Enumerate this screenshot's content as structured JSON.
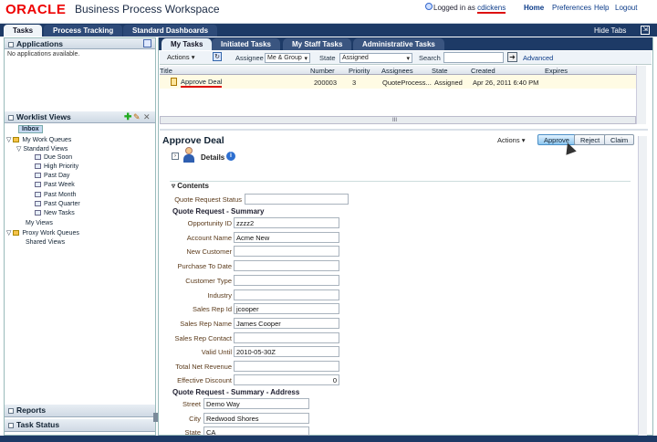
{
  "header": {
    "brand": "ORACLE",
    "app_title": "Business Process Workspace",
    "logged_in_prefix": "Logged in as",
    "user": "cdickens",
    "links": [
      "Home",
      "Preferences",
      "Help",
      "Logout"
    ]
  },
  "main_tabs": [
    "Tasks",
    "Process Tracking",
    "Standard Dashboards"
  ],
  "hide_tabs": "Hide Tabs",
  "left": {
    "applications_title": "Applications",
    "no_apps": "No applications available.",
    "worklist_title": "Worklist Views",
    "tree": [
      "Inbox",
      "My Work Queues",
      "Standard Views",
      "Due Soon",
      "High Priority",
      "Past Day",
      "Past Week",
      "Past Month",
      "Past Quarter",
      "New Tasks",
      "My Views",
      "Proxy Work Queues",
      "Shared Views"
    ],
    "reports_title": "Reports",
    "taskstatus_title": "Task Status"
  },
  "sub_tabs": [
    "My Tasks",
    "Initiated Tasks",
    "My Staff Tasks",
    "Administrative Tasks"
  ],
  "toolbar": {
    "actions": "Actions",
    "assignee_label": "Assignee",
    "assignee_value": "Me & Group",
    "state_label": "State",
    "state_value": "Assigned",
    "search_label": "Search",
    "search_value": "",
    "advanced": "Advanced"
  },
  "grid": {
    "columns": [
      "Title",
      "Number",
      "Priority",
      "Assignees",
      "State",
      "Created",
      "Expires"
    ],
    "row": {
      "title": "Approve Deal",
      "number": "200003",
      "priority": "3",
      "assignees": "QuoteProcess...",
      "state": "Assigned",
      "created": "Apr 26, 2011 6:40 PM",
      "expires": ""
    },
    "scroll_handle": "III"
  },
  "detail": {
    "title": "Approve Deal",
    "actions": "Actions",
    "buttons": [
      "Approve",
      "Reject",
      "Claim"
    ],
    "details_label": "Details",
    "contents_label": "Contents",
    "quote_status_label": "Quote Request Status",
    "summary_label": "Quote Request - Summary",
    "fields": [
      {
        "label": "Opportunity ID",
        "value": "zzzz2"
      },
      {
        "label": "Account Name",
        "value": "Acme New"
      },
      {
        "label": "New Customer",
        "value": ""
      },
      {
        "label": "Purchase To Date",
        "value": ""
      },
      {
        "label": "Customer Type",
        "value": ""
      },
      {
        "label": "Industry",
        "value": ""
      },
      {
        "label": "Sales Rep Id",
        "value": "jcooper"
      },
      {
        "label": "Sales Rep Name",
        "value": "James Cooper"
      },
      {
        "label": "Sales Rep Contact",
        "value": ""
      },
      {
        "label": "Valid Until",
        "value": "2010-05-30Z"
      },
      {
        "label": "Total Net Revenue",
        "value": ""
      },
      {
        "label": "Effective Discount",
        "value": "0"
      }
    ],
    "address_label": "Quote Request - Summary - Address",
    "address": [
      {
        "label": "Street",
        "value": "Demo Way"
      },
      {
        "label": "City",
        "value": "Redwood Shores"
      },
      {
        "label": "State",
        "value": "CA"
      }
    ]
  }
}
